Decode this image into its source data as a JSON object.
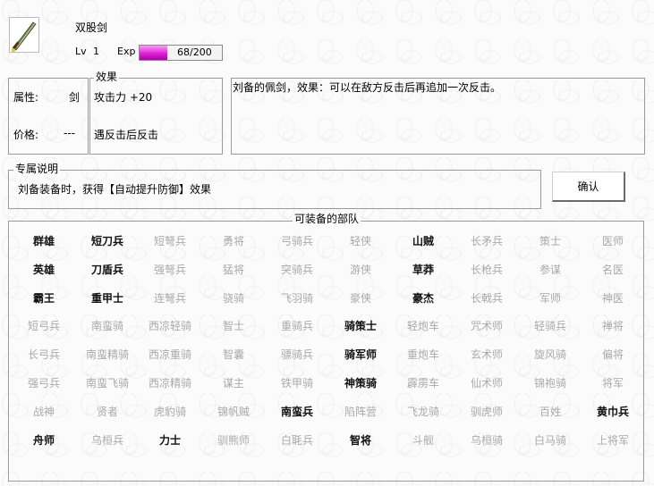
{
  "item": {
    "name": "双股剑",
    "level_label": "Lv",
    "level": "1",
    "exp_label": "Exp",
    "exp_text": "68/200",
    "exp_fraction": 0.34,
    "icon": "sword-icon"
  },
  "effect_box": {
    "legend": "效果",
    "attr_label": "属性:",
    "attr_value": "剑",
    "price_label": "价格:",
    "price_value": "---",
    "effect1": "攻击力 +20",
    "effect2": "遇反击后反击"
  },
  "description": "刘备的佩剑，效果：可以在敌方反击后再追加一次反击。",
  "exclusive": {
    "legend": "专属说明",
    "text": "刘备装备时，获得【自动提升防御】效果"
  },
  "confirm_label": "确认",
  "units": {
    "legend": "可装备的部队",
    "rows": [
      [
        [
          "群雄",
          1
        ],
        [
          "短刀兵",
          1
        ],
        [
          "短弩兵",
          0
        ],
        [
          "勇将",
          0
        ],
        [
          "弓骑兵",
          0
        ],
        [
          "轻侠",
          0
        ],
        [
          "山贼",
          1
        ],
        [
          "长矛兵",
          0
        ],
        [
          "策士",
          0
        ],
        [
          "医师",
          0
        ]
      ],
      [
        [
          "英雄",
          1
        ],
        [
          "刀盾兵",
          1
        ],
        [
          "强弩兵",
          0
        ],
        [
          "猛将",
          0
        ],
        [
          "突骑兵",
          0
        ],
        [
          "游侠",
          0
        ],
        [
          "草莽",
          1
        ],
        [
          "长枪兵",
          0
        ],
        [
          "参谋",
          0
        ],
        [
          "名医",
          0
        ]
      ],
      [
        [
          "霸王",
          1
        ],
        [
          "重甲士",
          1
        ],
        [
          "连弩兵",
          0
        ],
        [
          "骁骑",
          0
        ],
        [
          "飞羽骑",
          0
        ],
        [
          "豪侠",
          0
        ],
        [
          "豪杰",
          1
        ],
        [
          "长戟兵",
          0
        ],
        [
          "军师",
          0
        ],
        [
          "神医",
          0
        ]
      ],
      [
        [
          "短弓兵",
          0
        ],
        [
          "南蛮骑",
          0
        ],
        [
          "西凉轻骑",
          0
        ],
        [
          "智士",
          0
        ],
        [
          "重骑兵",
          0
        ],
        [
          "骑策士",
          1
        ],
        [
          "轻炮车",
          0
        ],
        [
          "咒术师",
          0
        ],
        [
          "轻骑兵",
          0
        ],
        [
          "禅将",
          0
        ]
      ],
      [
        [
          "长弓兵",
          0
        ],
        [
          "南蛮精骑",
          0
        ],
        [
          "西凉重骑",
          0
        ],
        [
          "智囊",
          0
        ],
        [
          "骠骑兵",
          0
        ],
        [
          "骑军师",
          1
        ],
        [
          "重炮车",
          0
        ],
        [
          "玄术师",
          0
        ],
        [
          "旋风骑",
          0
        ],
        [
          "偏将",
          0
        ]
      ],
      [
        [
          "强弓兵",
          0
        ],
        [
          "南蛮飞骑",
          0
        ],
        [
          "西凉精骑",
          0
        ],
        [
          "谋主",
          0
        ],
        [
          "铁甲骑",
          0
        ],
        [
          "神策骑",
          1
        ],
        [
          "霹雳车",
          0
        ],
        [
          "仙术师",
          0
        ],
        [
          "锦袍骑",
          0
        ],
        [
          "将军",
          0
        ]
      ],
      [
        [
          "战神",
          0
        ],
        [
          "贤者",
          0
        ],
        [
          "虎豹骑",
          0
        ],
        [
          "锦帆贼",
          0
        ],
        [
          "南蛮兵",
          1
        ],
        [
          "陷阵营",
          0
        ],
        [
          "飞龙骑",
          0
        ],
        [
          "驯虎师",
          0
        ],
        [
          "百姓",
          0
        ],
        [
          "黄巾兵",
          1
        ]
      ],
      [
        [
          "舟师",
          1
        ],
        [
          "乌桓兵",
          0
        ],
        [
          "力士",
          1
        ],
        [
          "驯熊师",
          0
        ],
        [
          "白毦兵",
          0
        ],
        [
          "智将",
          1
        ],
        [
          "斗舰",
          0
        ],
        [
          "乌桓骑",
          0
        ],
        [
          "白马骑",
          0
        ],
        [
          "上将军",
          0
        ]
      ]
    ]
  },
  "colors": {
    "exp_fill": "#e020d8",
    "enabled_text": "#111111",
    "disabled_text": "#a9a9a9"
  }
}
